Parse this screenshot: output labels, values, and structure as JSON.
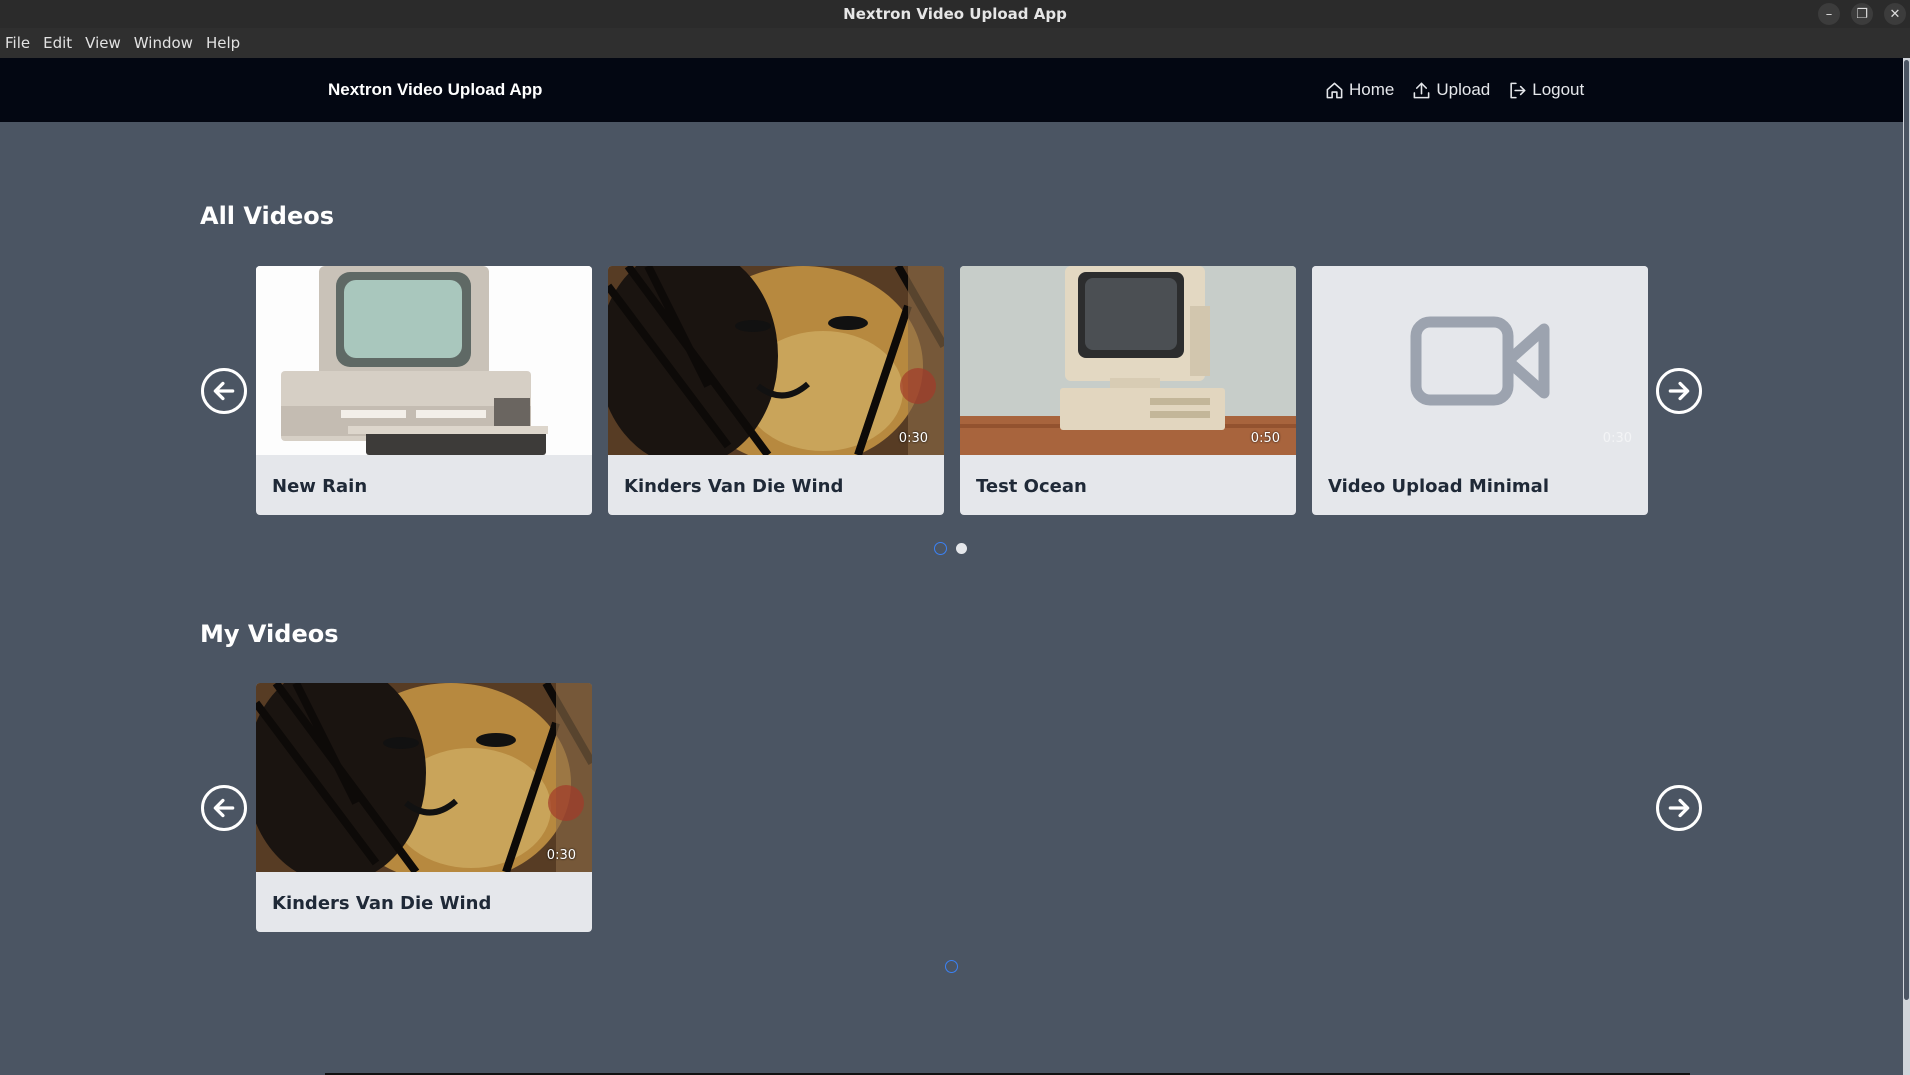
{
  "window": {
    "title": "Nextron Video Upload App",
    "controls": [
      "minimize-icon",
      "restore-icon",
      "close-icon"
    ]
  },
  "menubar": {
    "items": [
      "File",
      "Edit",
      "View",
      "Window",
      "Help"
    ]
  },
  "navbar": {
    "brand": "Nextron Video Upload App",
    "links": [
      {
        "label": "Home",
        "icon": "home-icon"
      },
      {
        "label": "Upload",
        "icon": "upload-icon"
      },
      {
        "label": "Logout",
        "icon": "logout-icon"
      }
    ]
  },
  "all_videos": {
    "title": "All Videos",
    "videos": [
      {
        "title": "New Rain",
        "duration": "",
        "thumbnail": "retro-computer-white"
      },
      {
        "title": "Kinders Van Die Wind",
        "duration": "0:30",
        "thumbnail": "abstract-face-painting"
      },
      {
        "title": "Test Ocean",
        "duration": "0:50",
        "thumbnail": "retro-computer-beige"
      },
      {
        "title": "Video Upload Minimal",
        "duration": "0:30",
        "thumbnail": "video-camera-icon"
      }
    ],
    "pagination": {
      "pages": 2,
      "current": 1
    }
  },
  "my_videos": {
    "title": "My Videos",
    "videos": [
      {
        "title": "Kinders Van Die Wind",
        "duration": "0:30",
        "thumbnail": "abstract-face-painting"
      }
    ],
    "pagination": {
      "pages": 1,
      "current": 1
    }
  },
  "colors": {
    "page_bg": "#4b5563",
    "navbar_bg": "#030712",
    "card_bg": "#e5e7eb",
    "active_dot": "#3b82f6"
  }
}
